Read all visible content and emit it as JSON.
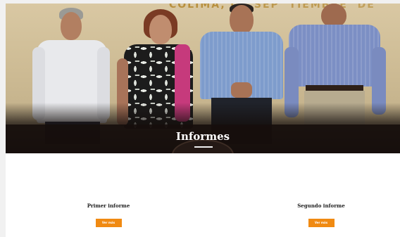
{
  "hero": {
    "wall_text": "COLIMA, … SEP … (partially hidden)",
    "title": "Informes"
  },
  "reports": [
    {
      "title": "Primer informe",
      "button_label": "Ver más"
    },
    {
      "title": "Segundo informe",
      "button_label": "Ver más"
    }
  ],
  "colors": {
    "accent": "#f08a12",
    "hero_band": "#1a110e",
    "page_bg": "#f1f1f1",
    "content_bg": "#ffffff"
  }
}
